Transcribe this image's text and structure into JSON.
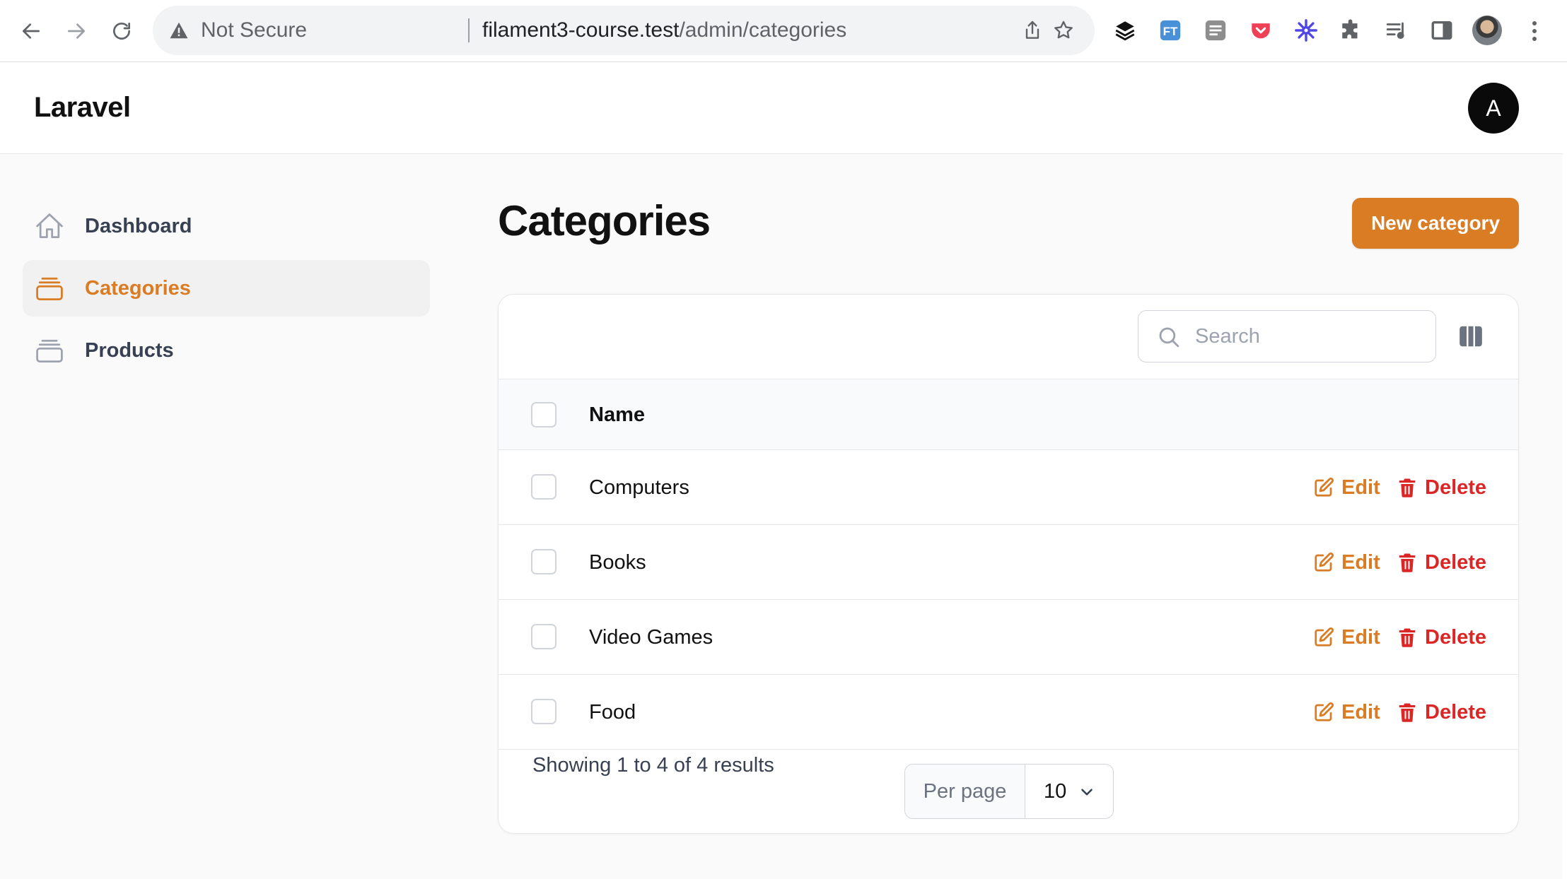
{
  "browser": {
    "security_label": "Not Secure",
    "url_host": "filament3-course.test",
    "url_path": "/admin/categories",
    "extensions": [
      "layers-icon",
      "ft-extension-icon",
      "stack-extension-icon",
      "pocket-icon",
      "snowflake-extension-icon",
      "puzzle-icon",
      "reading-list-icon",
      "side-panel-icon"
    ]
  },
  "app": {
    "brand": "Laravel",
    "avatar_initial": "A"
  },
  "sidebar": {
    "items": [
      {
        "label": "Dashboard",
        "icon": "home-icon",
        "active": false
      },
      {
        "label": "Categories",
        "icon": "rectangle-stack-icon",
        "active": true
      },
      {
        "label": "Products",
        "icon": "rectangle-stack-icon",
        "active": false
      }
    ]
  },
  "main": {
    "title": "Categories",
    "new_button": "New category"
  },
  "table": {
    "search_placeholder": "Search",
    "column_name": "Name",
    "rows": [
      {
        "name": "Computers"
      },
      {
        "name": "Books"
      },
      {
        "name": "Video Games"
      },
      {
        "name": "Food"
      }
    ],
    "edit_label": "Edit",
    "delete_label": "Delete",
    "summary": "Showing 1 to 4 of 4 results",
    "per_page_label": "Per page",
    "per_page_value": "10"
  },
  "colors": {
    "accent": "#d97c24",
    "danger": "#dc2626"
  }
}
